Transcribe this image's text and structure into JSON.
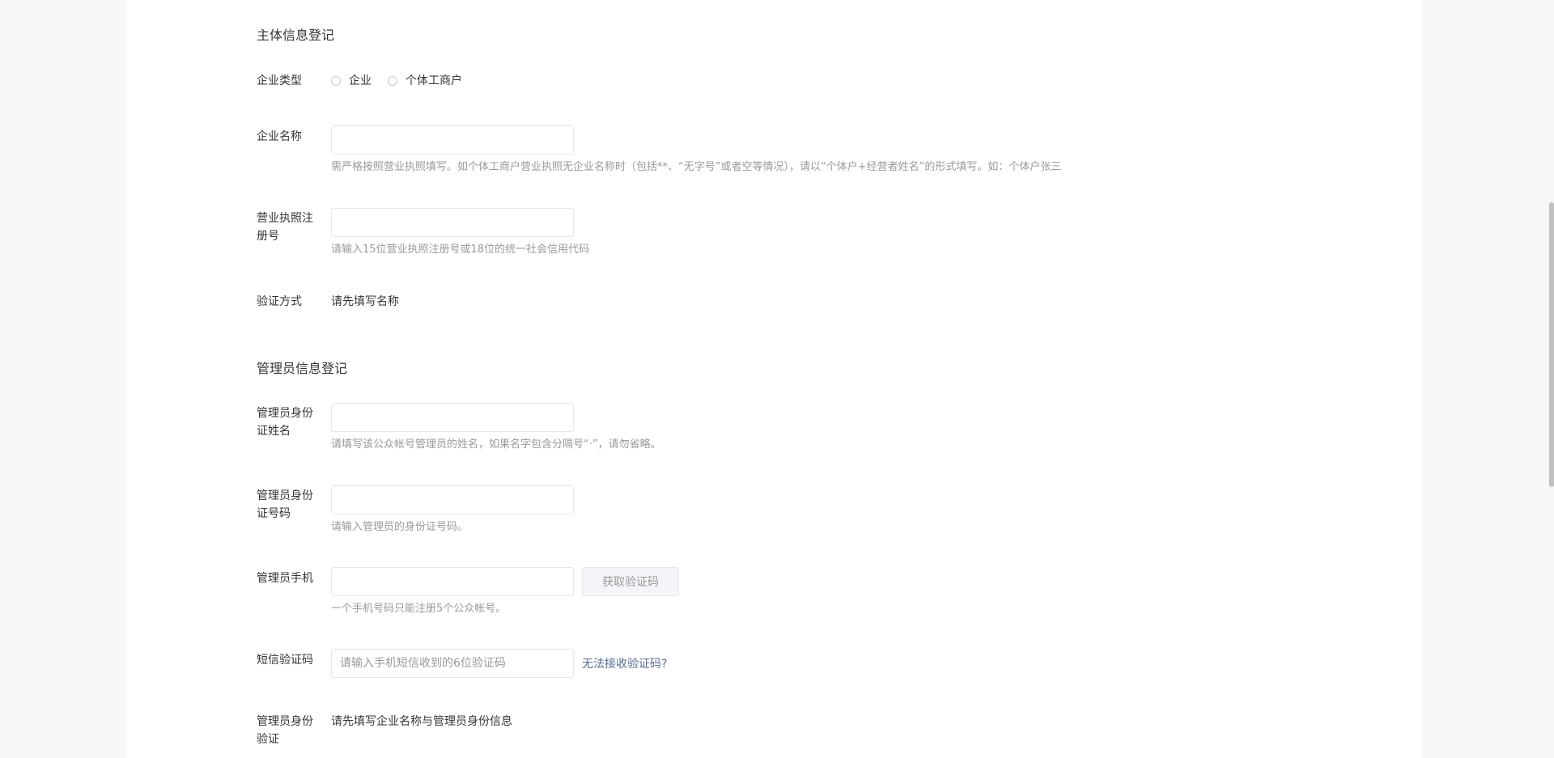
{
  "entity_section": {
    "title": "主体信息登记",
    "enterprise_type": {
      "label": "企业类型",
      "options": [
        "企业",
        "个体工商户"
      ]
    },
    "enterprise_name": {
      "label": "企业名称",
      "value": "",
      "hint": "需严格按照营业执照填写。如个体工商户营业执照无企业名称时（包括**、“无字号”或者空等情况），请以“个体户+经营者姓名”的形式填写。如：个体户张三"
    },
    "license_number": {
      "label": "营业执照注册号",
      "value": "",
      "hint": "请输入15位营业执照注册号或18位的统一社会信用代码"
    },
    "verify_method": {
      "label": "验证方式",
      "value": "请先填写名称"
    }
  },
  "admin_section": {
    "title": "管理员信息登记",
    "id_name": {
      "label": "管理员身份证姓名",
      "value": "",
      "hint": "请填写该公众帐号管理员的姓名，如果名字包含分隔号“·”，请勿省略。"
    },
    "id_number": {
      "label": "管理员身份证号码",
      "value": "",
      "hint": "请输入管理员的身份证号码。"
    },
    "phone": {
      "label": "管理员手机",
      "value": "",
      "button_label": "获取验证码",
      "hint": "一个手机号码只能注册5个公众帐号。"
    },
    "sms_code": {
      "label": "短信验证码",
      "placeholder": "请输入手机短信收到的6位验证码",
      "link_label": "无法接收验证码?"
    },
    "identity_verify": {
      "label": "管理员身份验证",
      "value": "请先填写企业名称与管理员身份信息"
    }
  }
}
